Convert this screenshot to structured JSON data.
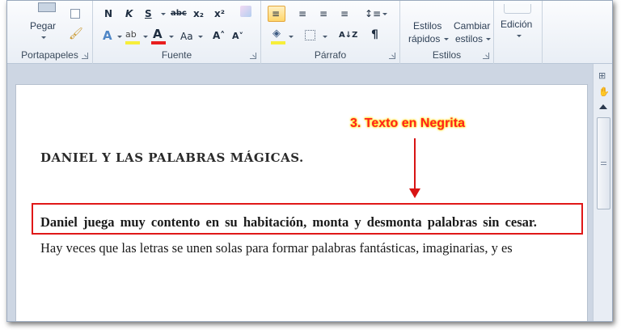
{
  "ribbon": {
    "clipboard": {
      "paste_label": "Pegar",
      "group_label": "Portapapeles"
    },
    "font": {
      "group_label": "Fuente",
      "bold": "N",
      "italic": "K",
      "underline": "S",
      "strike": "abc",
      "subscript": "x₂",
      "superscript": "x²",
      "change_case": "Aa",
      "grow": "A˄",
      "shrink": "A˅",
      "font_color_hex": "#e81e1e",
      "highlight_hex": "#f7ee3a"
    },
    "paragraph": {
      "group_label": "Párrafo",
      "pilcrow": "¶",
      "sort": "A↓Z"
    },
    "styles": {
      "group_label": "Estilos",
      "quick_line1": "Estilos",
      "quick_line2": "rápidos",
      "change_line1": "Cambiar",
      "change_line2": "estilos"
    },
    "editing": {
      "label": "Edición"
    }
  },
  "document": {
    "title": "DANIEL Y LAS PALABRAS MÁGICAS.",
    "bold_sentence": "Daniel juega muy contento en su habitación, monta y desmonta palabras sin cesar.",
    "next_line": "Hay veces que las letras se unen solas para formar palabras fantásticas, imaginarias, y es"
  },
  "annotation": {
    "text": "3. Texto en Negrita",
    "color_hex": "#ff2020"
  }
}
